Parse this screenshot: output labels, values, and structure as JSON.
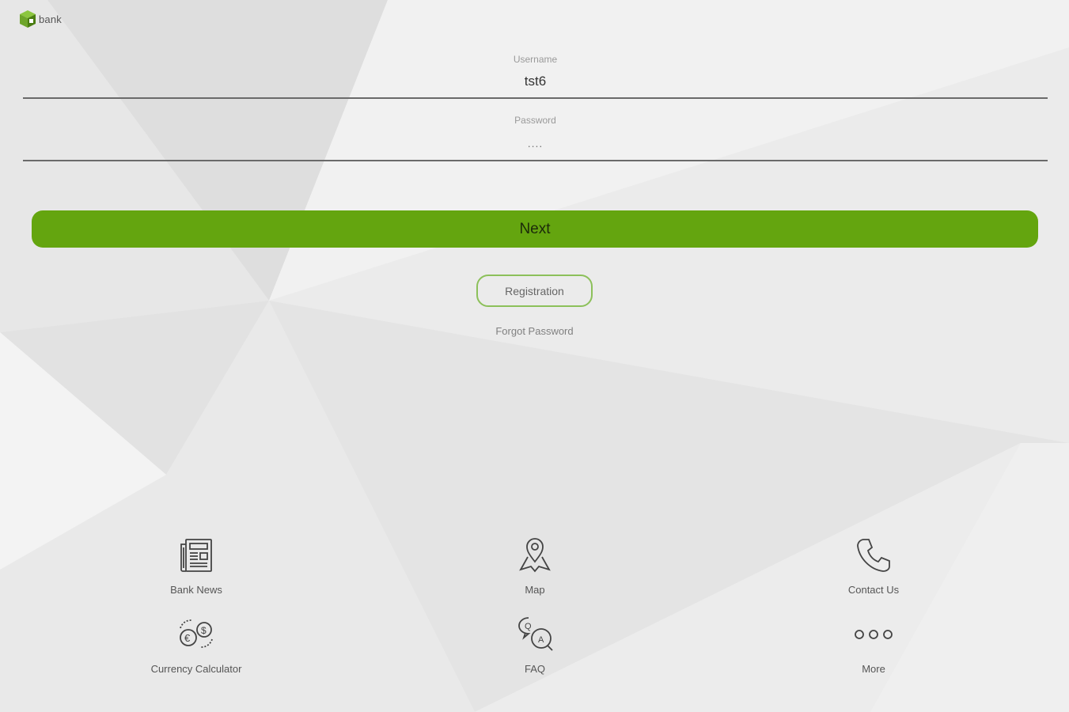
{
  "logo": {
    "text": "bank"
  },
  "login": {
    "username_label": "Username",
    "username_value": "tst6",
    "password_label": "Password",
    "password_value": "....",
    "next_label": "Next",
    "registration_label": "Registration",
    "forgot_label": "Forgot Password"
  },
  "tiles": [
    {
      "label": "Bank News",
      "icon": "newspaper-icon"
    },
    {
      "label": "Map",
      "icon": "map-pin-icon"
    },
    {
      "label": "Contact Us",
      "icon": "phone-icon"
    },
    {
      "label": "Currency Calculator",
      "icon": "currency-exchange-icon"
    },
    {
      "label": "FAQ",
      "icon": "faq-chat-icon"
    },
    {
      "label": "More",
      "icon": "more-dots-icon"
    }
  ],
  "colors": {
    "accent": "#64a50f",
    "registration_border": "#8cc05a",
    "background": "#eeeeee"
  }
}
